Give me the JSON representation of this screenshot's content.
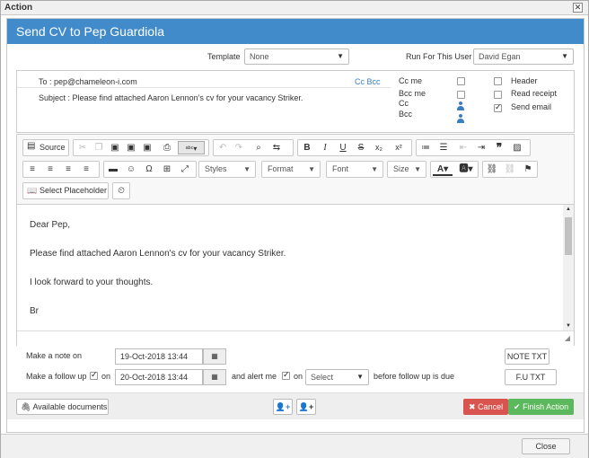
{
  "window": {
    "title": "Action",
    "close_glyph": "✕"
  },
  "header": {
    "title": "Send CV to Pep Guardiola"
  },
  "template": {
    "label": "Template",
    "value": "None"
  },
  "run_for": {
    "label": "Run For This User",
    "value": "David Egan"
  },
  "mail": {
    "to": "To : pep@chameleon-i.com",
    "cc_bcc": "Cc Bcc",
    "subject": "Subject : Please find attached Aaron Lennon's cv for your vacancy Striker.",
    "options": {
      "cc_me": "Cc me",
      "bcc_me": "Bcc me",
      "cc": "Cc",
      "bcc": "Bcc",
      "header": "Header",
      "read_receipt": "Read receipt",
      "send_email": "Send email"
    }
  },
  "toolbar": {
    "source": "Source",
    "styles": "Styles",
    "format": "Format",
    "font": "Font",
    "size": "Size",
    "select_placeholder": "Select Placeholder"
  },
  "body": {
    "lines": [
      "Dear Pep,",
      "Please find attached Aaron Lennon's cv for your vacancy Striker.",
      "I look forward to your thoughts.",
      "Br"
    ]
  },
  "note": {
    "label": "Make a note on",
    "date": "19-Oct-2018 13:44",
    "button": "NOTE TXT"
  },
  "followup": {
    "label": "Make a follow up",
    "on1": "on",
    "date": "20-Oct-2018 13:44",
    "alert": "and alert me",
    "on2": "on",
    "select": "Select",
    "suffix": "before follow up is due",
    "button": "F.U TXT"
  },
  "footer": {
    "available_docs": "Available documents",
    "cancel": "Cancel",
    "finish": "Finish Action"
  },
  "close": {
    "label": "Close"
  },
  "colors": {
    "header": "#428bca",
    "cancel": "#d9534f",
    "finish": "#5cb85c"
  }
}
